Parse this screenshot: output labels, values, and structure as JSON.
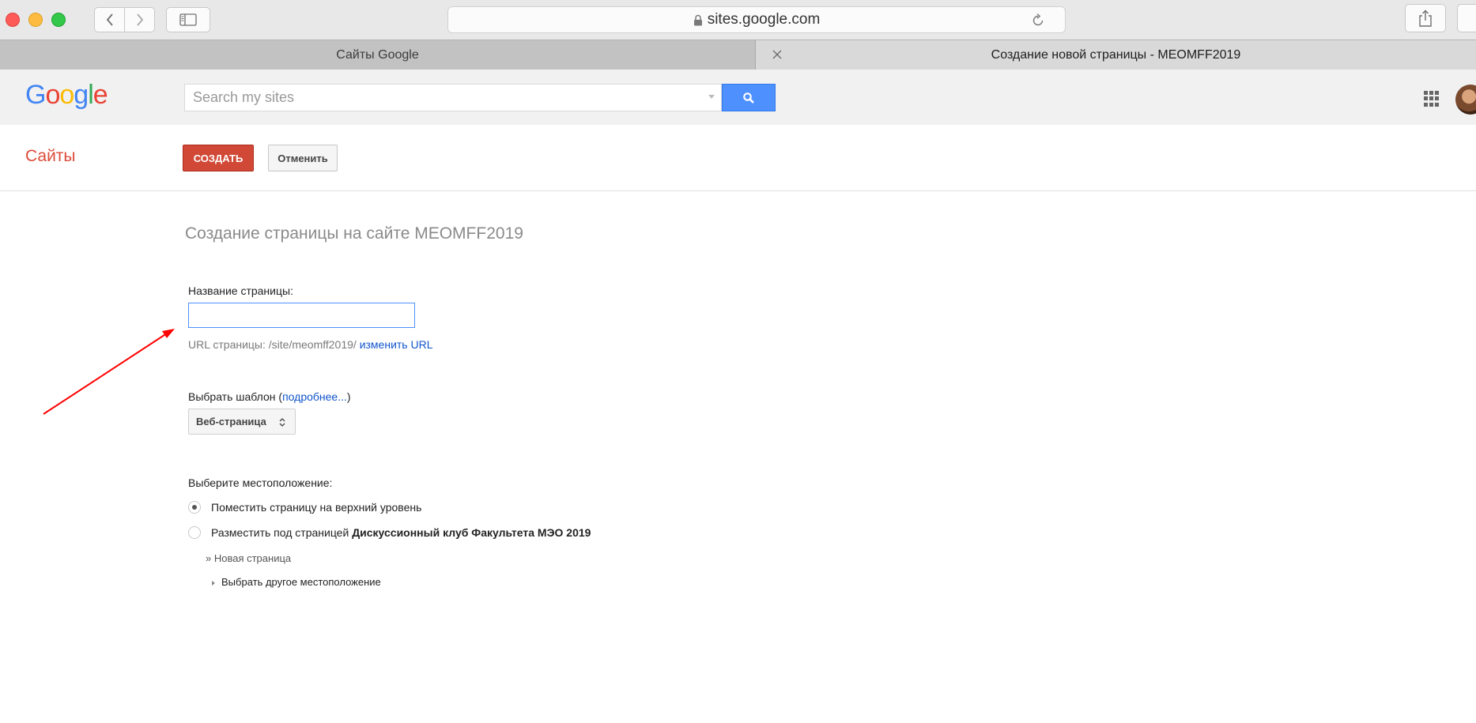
{
  "browser": {
    "address": "sites.google.com",
    "tabs": [
      {
        "label": "Сайты Google"
      },
      {
        "label": "Создание новой страницы - MEOMFF2019"
      }
    ]
  },
  "google_header": {
    "logo_letters": [
      {
        "char": "G",
        "color": "#4285f4"
      },
      {
        "char": "o",
        "color": "#ea4335"
      },
      {
        "char": "o",
        "color": "#fbbc05"
      },
      {
        "char": "g",
        "color": "#4285f4"
      },
      {
        "char": "l",
        "color": "#34a853"
      },
      {
        "char": "e",
        "color": "#ea4335"
      }
    ],
    "search_placeholder": "Search my sites",
    "search_value": ""
  },
  "sites_bar": {
    "title": "Сайты",
    "create_label": "СОЗДАТЬ",
    "cancel_label": "Отменить"
  },
  "form": {
    "heading": "Создание страницы на сайте MEOMFF2019",
    "page_title_label": "Название страницы:",
    "page_title_value": "",
    "url_prefix": "URL страницы: /site/meomff2019/",
    "url_change_link": "изменить URL",
    "template_label": "Выбрать шаблон (",
    "template_more_link": "подробнее...",
    "template_label_end": ")",
    "template_selected": "Веб-страница",
    "location_label": "Выберите местоположение:",
    "option_top": "Поместить страницу на верхний уровень",
    "option_under_prefix": "Разместить под страницей",
    "option_under_page": "Дискуссионный клуб Факультета МЭО 2019",
    "new_page": "» Новая страница",
    "choose_other": "Выбрать другое местоположение"
  },
  "colors": {
    "annotation_arrow": "#ff0000",
    "create_button": "#d14836",
    "sites_title": "#dd4b39",
    "search_button": "#4d90fe"
  }
}
